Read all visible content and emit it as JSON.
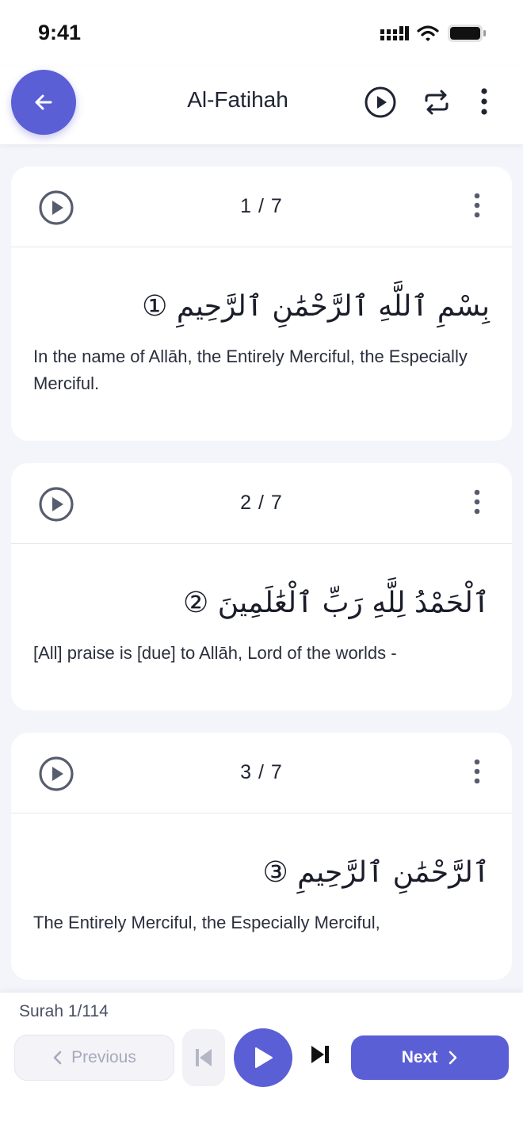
{
  "status_bar": {
    "time": "9:41"
  },
  "header": {
    "title": "Al-Fatihah"
  },
  "ayahs": [
    {
      "number": "1 / 7",
      "arabic": "بِسْمِ ٱللَّهِ ٱلرَّحْمَٰنِ ٱلرَّحِيمِ ①",
      "translation": "In the name of Allāh, the Entirely Merciful, the Especially Merciful."
    },
    {
      "number": "2 / 7",
      "arabic": "ٱلْحَمْدُ لِلَّهِ رَبِّ ٱلْعَٰلَمِينَ ②",
      "translation": "[All] praise is [due] to Allāh, Lord of the worlds -"
    },
    {
      "number": "3 / 7",
      "arabic": "ٱلرَّحْمَٰنِ ٱلرَّحِيمِ ③",
      "translation": "The Entirely Merciful, the Especially Merciful,"
    }
  ],
  "bottom": {
    "surah_count": "Surah 1/114",
    "previous_label": "Previous",
    "next_label": "Next"
  },
  "colors": {
    "accent": "#5b5fd6",
    "background": "#f4f4fb",
    "card": "#ffffff"
  }
}
